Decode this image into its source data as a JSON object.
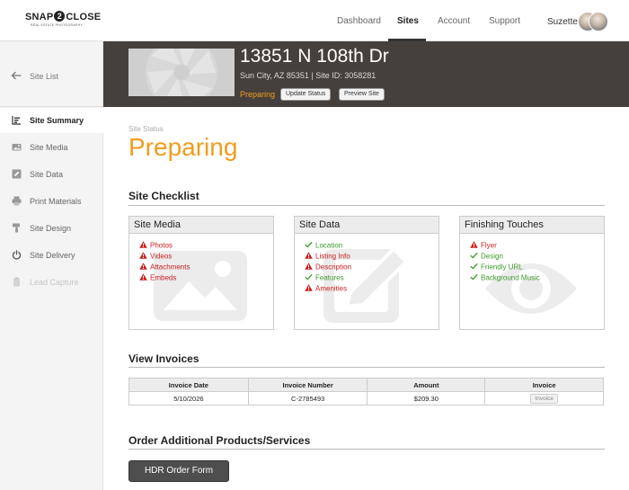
{
  "brand": {
    "logo_left": "SNAP",
    "logo_mid": "2",
    "logo_right": "CLOSE",
    "logo_sub": "REAL ESTATE PHOTOGRAPHY"
  },
  "nav": {
    "items": [
      {
        "label": "Dashboard",
        "active": false
      },
      {
        "label": "Sites",
        "active": true
      },
      {
        "label": "Account",
        "active": false
      },
      {
        "label": "Support",
        "active": false
      }
    ],
    "user_name": "Suzette"
  },
  "sidebar": {
    "back_label": "Site List",
    "items": [
      {
        "label": "Site Summary",
        "icon": "summary-list-icon",
        "active": true,
        "disabled": false
      },
      {
        "label": "Site Media",
        "icon": "media-image-icon",
        "active": false,
        "disabled": false
      },
      {
        "label": "Site Data",
        "icon": "data-pencil-icon",
        "active": false,
        "disabled": false
      },
      {
        "label": "Print Materials",
        "icon": "printer-icon",
        "active": false,
        "disabled": false
      },
      {
        "label": "Site Design",
        "icon": "paint-roller-icon",
        "active": false,
        "disabled": false
      },
      {
        "label": "Site Delivery",
        "icon": "power-icon",
        "active": false,
        "disabled": false
      },
      {
        "label": "Lead Capture",
        "icon": "clipboard-icon",
        "active": false,
        "disabled": true
      }
    ]
  },
  "header": {
    "address": "13851 N 108th Dr",
    "sub_address": "Sun City, AZ  85351 | Site ID: 3058281",
    "status": "Preparing",
    "update_status_label": "Update Status",
    "preview_site_label": "Preview Site"
  },
  "site_status": {
    "label": "Site Status",
    "value": "Preparing"
  },
  "checklist": {
    "title": "Site Checklist",
    "cards": [
      {
        "title": "Site Media",
        "bg_icon": "image-icon",
        "items": [
          {
            "label": "Photos",
            "done": false
          },
          {
            "label": "Videos",
            "done": false
          },
          {
            "label": "Attachments",
            "done": false
          },
          {
            "label": "Embeds",
            "done": false
          }
        ]
      },
      {
        "title": "Site Data",
        "bg_icon": "pencil-icon",
        "items": [
          {
            "label": "Location",
            "done": true
          },
          {
            "label": "Listing Info",
            "done": false
          },
          {
            "label": "Description",
            "done": false
          },
          {
            "label": "Features",
            "done": true
          },
          {
            "label": "Amenities",
            "done": false
          }
        ]
      },
      {
        "title": "Finishing Touches",
        "bg_icon": "eye-icon",
        "items": [
          {
            "label": "Flyer",
            "done": false
          },
          {
            "label": "Design",
            "done": true
          },
          {
            "label": "Friendly URL",
            "done": true
          },
          {
            "label": "Background Music",
            "done": true
          }
        ]
      }
    ]
  },
  "invoices": {
    "title": "View Invoices",
    "columns": [
      "Invoice Date",
      "Invoice Number",
      "Amount",
      "Invoice"
    ],
    "rows": [
      {
        "date": "5/10/2026",
        "number": "C-2785493",
        "amount": "$209.30",
        "button": "Invoice"
      }
    ]
  },
  "order": {
    "title": "Order Additional Products/Services",
    "button_label": "HDR Order Form"
  },
  "colors": {
    "warn": "#cc1f1f",
    "ok": "#3c9a2a",
    "accent": "#f29c1e",
    "header_bg": "#45403c"
  }
}
